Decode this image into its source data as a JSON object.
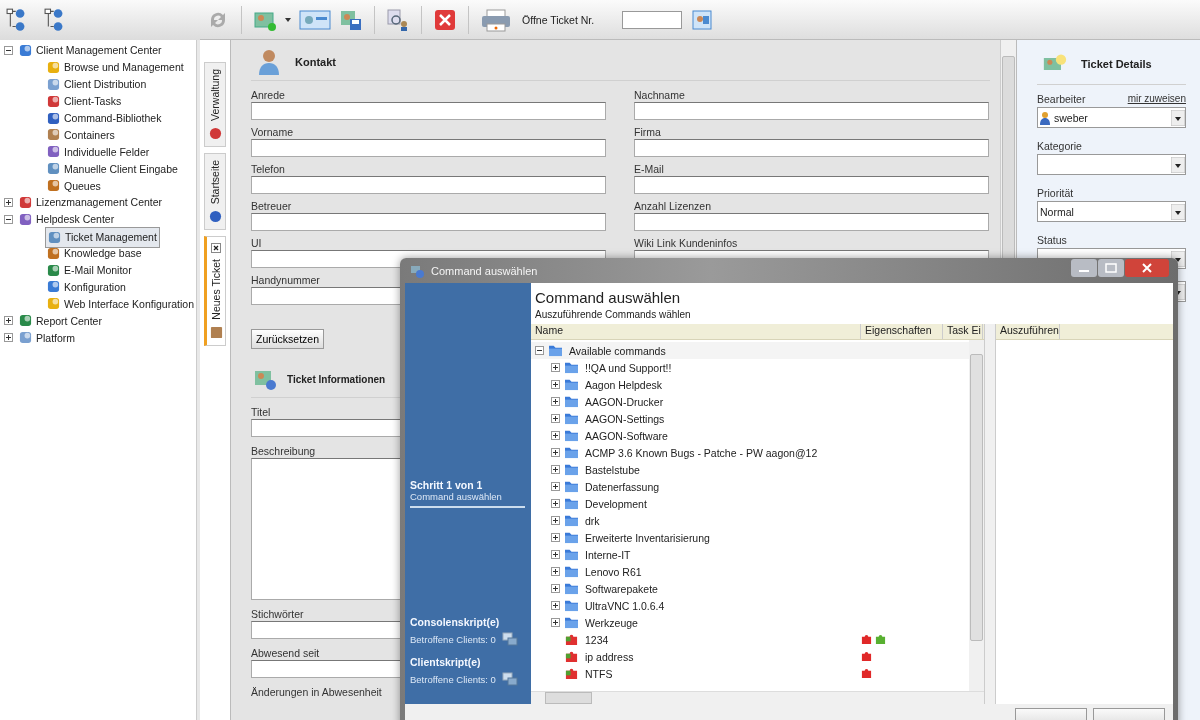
{
  "sidebar": {
    "tree": [
      {
        "label": "Client Management Center",
        "expanded": true,
        "selected": false,
        "children": [
          {
            "label": "Browse und Management",
            "selected": false
          },
          {
            "label": "Client Distribution",
            "selected": false
          },
          {
            "label": "Client-Tasks",
            "selected": false
          },
          {
            "label": "Command-Bibliothek",
            "selected": false
          },
          {
            "label": "Containers",
            "selected": false
          },
          {
            "label": "Individuelle Felder",
            "selected": false
          },
          {
            "label": "Manuelle Client Eingabe",
            "selected": false
          },
          {
            "label": "Queues",
            "selected": false
          }
        ]
      },
      {
        "label": "Lizenzmanagement Center",
        "expanded": false,
        "selected": false
      },
      {
        "label": "Helpdesk Center",
        "expanded": true,
        "selected": false,
        "children": [
          {
            "label": "Ticket Management",
            "selected": true
          },
          {
            "label": "Knowledge base",
            "selected": false
          },
          {
            "label": "E-Mail Monitor",
            "selected": false
          },
          {
            "label": "Konfiguration",
            "selected": false
          },
          {
            "label": "Web Interface Konfiguration",
            "selected": false
          }
        ]
      },
      {
        "label": "Report Center",
        "expanded": false,
        "selected": false
      },
      {
        "label": "Platform",
        "expanded": false,
        "selected": false
      }
    ]
  },
  "toolbar": {
    "ticket_number_label": "Öffne Ticket Nr."
  },
  "side_tabs": [
    {
      "label": "Verwaltung",
      "selected": false,
      "closable": false
    },
    {
      "label": "Startseite",
      "selected": false,
      "closable": false
    },
    {
      "label": "Neues Ticket",
      "selected": true,
      "closable": true
    }
  ],
  "contact": {
    "title": "Kontakt",
    "fields": [
      "Anrede",
      "Nachname",
      "Vorname",
      "Firma",
      "Telefon",
      "E-Mail",
      "Betreuer",
      "Anzahl Lizenzen",
      "UI",
      "Wiki Link Kundeninfos",
      "Handynummer"
    ],
    "reset_button": "Zurücksetzen"
  },
  "ticket_info": {
    "title": "Ticket Informationen",
    "fields": [
      {
        "label": "Titel",
        "kind": "input"
      },
      {
        "label": "Beschreibung",
        "kind": "textarea"
      },
      {
        "label": "Stichwörter",
        "kind": "input"
      },
      {
        "label": "Abwesend seit",
        "kind": "input"
      },
      {
        "label": "Änderungen in Abwesenheit",
        "kind": "label"
      }
    ]
  },
  "details": {
    "title": "Ticket Details",
    "assign_link": "mir zuweisen",
    "fields": [
      {
        "label": "Bearbeiter",
        "value": "sweber",
        "kind": "user"
      },
      {
        "label": "Kategorie",
        "kind": "select"
      },
      {
        "label": "Priorität",
        "value": "Normal",
        "kind": "select"
      },
      {
        "label": "Status",
        "kind": "select"
      },
      {
        "kind": "select"
      }
    ]
  },
  "dialog": {
    "title": "Command auswählen",
    "heading": "Command auswählen",
    "subheading": "Auszuführende Commands wählen",
    "step": {
      "title": "Schritt 1 von 1",
      "subtitle": "Command auswählen"
    },
    "scripts": [
      {
        "title": "Consolenskript(e)",
        "clients": "Betroffene Clients: 0"
      },
      {
        "title": "Clientskript(e)",
        "clients": "Betroffene Clients: 0"
      }
    ],
    "columns": [
      "Name",
      "Eigenschaften",
      "Task Ei"
    ],
    "selected_column": "Auszuführen",
    "tree": {
      "label": "Available commands",
      "expanded": true,
      "children": [
        {
          "label": "!!QA und Support!!",
          "kind": "folder",
          "expanded": false
        },
        {
          "label": "Aagon Helpdesk",
          "kind": "folder",
          "expanded": false
        },
        {
          "label": "AAGON-Drucker",
          "kind": "folder",
          "expanded": false
        },
        {
          "label": "AAGON-Settings",
          "kind": "folder",
          "expanded": false
        },
        {
          "label": "AAGON-Software",
          "kind": "folder",
          "expanded": false
        },
        {
          "label": "ACMP 3.6 Known Bugs - Patche - PW aagon@12",
          "kind": "folder",
          "expanded": false
        },
        {
          "label": "Bastelstube",
          "kind": "folder",
          "expanded": false
        },
        {
          "label": "Datenerfassung",
          "kind": "folder",
          "expanded": false
        },
        {
          "label": "Development",
          "kind": "folder",
          "expanded": false
        },
        {
          "label": "drk",
          "kind": "folder",
          "expanded": false
        },
        {
          "label": "Erweiterte Inventarisierung",
          "kind": "folder",
          "expanded": false
        },
        {
          "label": "Interne-IT",
          "kind": "folder",
          "expanded": false
        },
        {
          "label": "Lenovo R61",
          "kind": "folder",
          "expanded": false
        },
        {
          "label": "Softwarepakete",
          "kind": "folder",
          "expanded": false
        },
        {
          "label": "UltraVNC 1.0.6.4",
          "kind": "folder",
          "expanded": false
        },
        {
          "label": "Werkzeuge",
          "kind": "folder",
          "expanded": false
        },
        {
          "label": "1234",
          "kind": "command",
          "properties": [
            {
              "color": "#e02828"
            },
            {
              "color": "#58b030"
            }
          ]
        },
        {
          "label": "ip address",
          "kind": "command",
          "properties": [
            {
              "color": "#e02828"
            }
          ]
        },
        {
          "label": "NTFS",
          "kind": "command",
          "properties": [
            {
              "color": "#e02828"
            }
          ]
        }
      ]
    }
  }
}
